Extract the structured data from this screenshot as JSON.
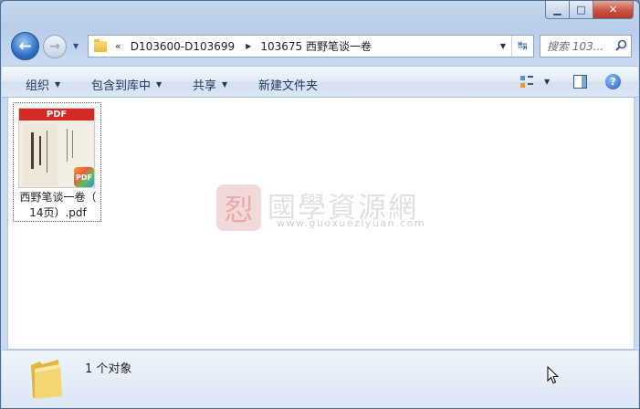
{
  "window": {
    "caption": {
      "minimize": "▁",
      "maximize": "□",
      "close": "✕"
    }
  },
  "nav": {
    "back_glyph": "←",
    "forward_glyph": "→",
    "dropdown_glyph": "▼"
  },
  "address": {
    "overflow_glyph": "«",
    "crumbs": [
      "D103600-D103699",
      "103675 西野笔谈一卷"
    ],
    "separator_glyph": "▶",
    "dropdown_glyph": "▼",
    "refresh_glyph": "↹"
  },
  "search": {
    "placeholder": "搜索 103..."
  },
  "commands": {
    "organize": "组织",
    "include_in_library": "包含到库中",
    "share": "共享",
    "new_folder": "新建文件夹",
    "arrow_glyph": "▼",
    "help_glyph": "?"
  },
  "files": [
    {
      "name_line1": "西野笔谈一卷（",
      "name_line2": "14页）.pdf",
      "thumb_banner": "PDF",
      "badge": "PDF"
    }
  ],
  "watermark": {
    "seal_glyph": "㤠",
    "text": "國學資源網",
    "url": "www.guoxueziyuan.com"
  },
  "status": {
    "count_text": "1 个对象"
  },
  "icons": {
    "back": "back-arrow-icon",
    "forward": "forward-arrow-icon",
    "folder": "folder-icon",
    "search": "search-icon",
    "refresh": "refresh-icon",
    "view": "view-options-icon",
    "preview_pane": "preview-pane-icon",
    "help": "help-icon",
    "pdf": "pdf-icon"
  }
}
